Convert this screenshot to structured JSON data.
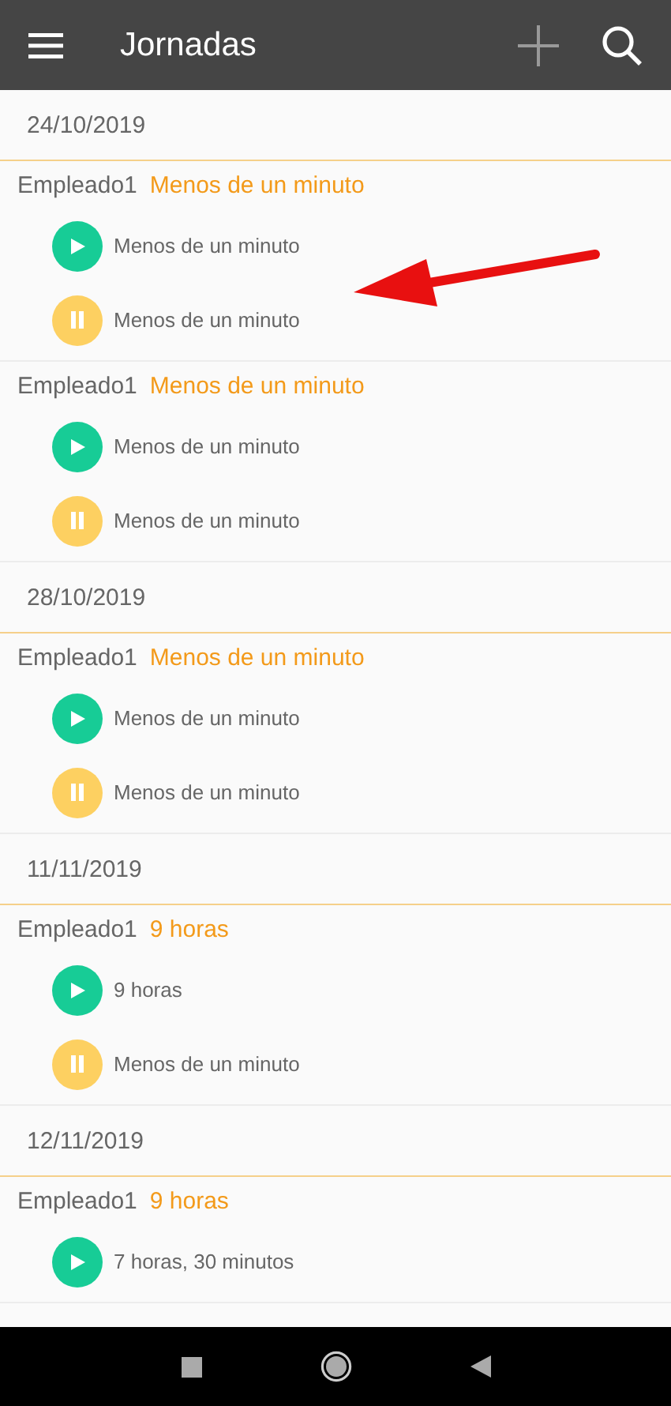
{
  "app_bar": {
    "title": "Jornadas"
  },
  "days": [
    {
      "date": "24/10/2019",
      "shifts": [
        {
          "employee": "Empleado1",
          "total": "Menos de un minuto",
          "entries": [
            {
              "kind": "start",
              "text": "Menos de un minuto"
            },
            {
              "kind": "pause",
              "text": "Menos de un minuto"
            }
          ]
        },
        {
          "employee": "Empleado1",
          "total": "Menos de un minuto",
          "entries": [
            {
              "kind": "start",
              "text": "Menos de un minuto"
            },
            {
              "kind": "pause",
              "text": "Menos de un minuto"
            }
          ]
        }
      ]
    },
    {
      "date": "28/10/2019",
      "shifts": [
        {
          "employee": "Empleado1",
          "total": "Menos de un minuto",
          "entries": [
            {
              "kind": "start",
              "text": "Menos de un minuto"
            },
            {
              "kind": "pause",
              "text": "Menos de un minuto"
            }
          ]
        }
      ]
    },
    {
      "date": "11/11/2019",
      "shifts": [
        {
          "employee": "Empleado1",
          "total": "9 horas",
          "entries": [
            {
              "kind": "start",
              "text": "9 horas"
            },
            {
              "kind": "pause",
              "text": "Menos de un minuto"
            }
          ]
        }
      ]
    },
    {
      "date": "12/11/2019",
      "shifts": [
        {
          "employee": "Empleado1",
          "total": "9 horas",
          "entries": [
            {
              "kind": "start",
              "text": "7 horas, 30 minutos"
            }
          ]
        }
      ]
    }
  ]
}
